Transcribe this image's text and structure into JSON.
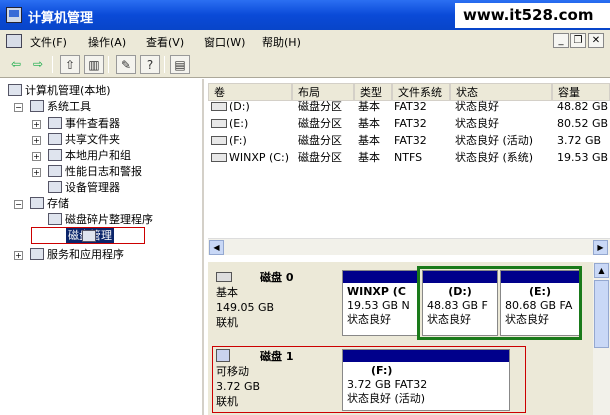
{
  "window": {
    "title": "计算机管理",
    "watermark": "www.it528.com"
  },
  "menu": [
    "文件(F)",
    "操作(A)",
    "查看(V)",
    "窗口(W)",
    "帮助(H)"
  ],
  "tree": {
    "root": "计算机管理(本地)",
    "system_tools": "系统工具",
    "event_viewer": "事件查看器",
    "shared_folders": "共享文件夹",
    "local_users": "本地用户和组",
    "perf_logs": "性能日志和警报",
    "device_manager": "设备管理器",
    "storage": "存储",
    "defrag": "磁盘碎片整理程序",
    "disk_mgmt": "磁盘管理",
    "services": "服务和应用程序"
  },
  "list": {
    "headers": [
      "卷",
      "布局",
      "类型",
      "文件系统",
      "状态",
      "容量"
    ],
    "rows": [
      [
        "(D:)",
        "磁盘分区",
        "基本",
        "FAT32",
        "状态良好",
        "48.82 GB"
      ],
      [
        "(E:)",
        "磁盘分区",
        "基本",
        "FAT32",
        "状态良好",
        "80.52 GB"
      ],
      [
        "(F:)",
        "磁盘分区",
        "基本",
        "FAT32",
        "状态良好 (活动)",
        "3.72 GB"
      ],
      [
        "WINXP (C:)",
        "磁盘分区",
        "基本",
        "NTFS",
        "状态良好 (系统)",
        "19.53 GB"
      ]
    ]
  },
  "disks": [
    {
      "name": "磁盘 0",
      "type": "基本",
      "size": "149.05 GB",
      "status": "联机",
      "partitions": [
        {
          "label": "WINXP  (C",
          "info": "19.53 GB N",
          "status": "状态良好"
        },
        {
          "label": "(D:)",
          "info": "48.83 GB F",
          "status": "状态良好"
        },
        {
          "label": "(E:)",
          "info": "80.68 GB FA",
          "status": "状态良好"
        }
      ]
    },
    {
      "name": "磁盘 1",
      "type": "可移动",
      "size": "3.72 GB",
      "status": "联机",
      "partitions": [
        {
          "label": "(F:)",
          "info": "3.72 GB FAT32",
          "status": "状态良好 (活动)"
        }
      ]
    }
  ],
  "colors": {
    "titlebar": "#0a4ad8",
    "partition_bar": "#00008b",
    "highlight_green": "#1a7a1a",
    "highlight_red": "#cc0000"
  }
}
